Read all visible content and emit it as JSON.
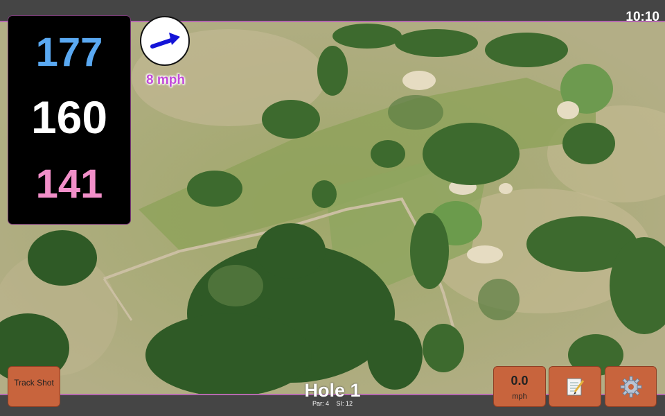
{
  "status_bar": {
    "time": "10:10"
  },
  "yardages": {
    "back": "177",
    "middle": "160",
    "front": "141"
  },
  "wind": {
    "speed": "8 mph",
    "direction_icon": "arrow-east-northeast-icon"
  },
  "buttons": {
    "track_shot": "Track Shot",
    "speed_value": "0.0",
    "speed_unit": "mph",
    "notes_icon": "notepad-icon",
    "settings_icon": "gear-icon"
  },
  "hole": {
    "title": "Hole 1",
    "par": "Par: 4",
    "si": "SI: 12"
  },
  "colors": {
    "back_yardage": "#5aa9f2",
    "middle_yardage": "#ffffff",
    "front_yardage": "#f28fc9",
    "wind_text": "#c24bd9",
    "button": "#c8643d"
  }
}
